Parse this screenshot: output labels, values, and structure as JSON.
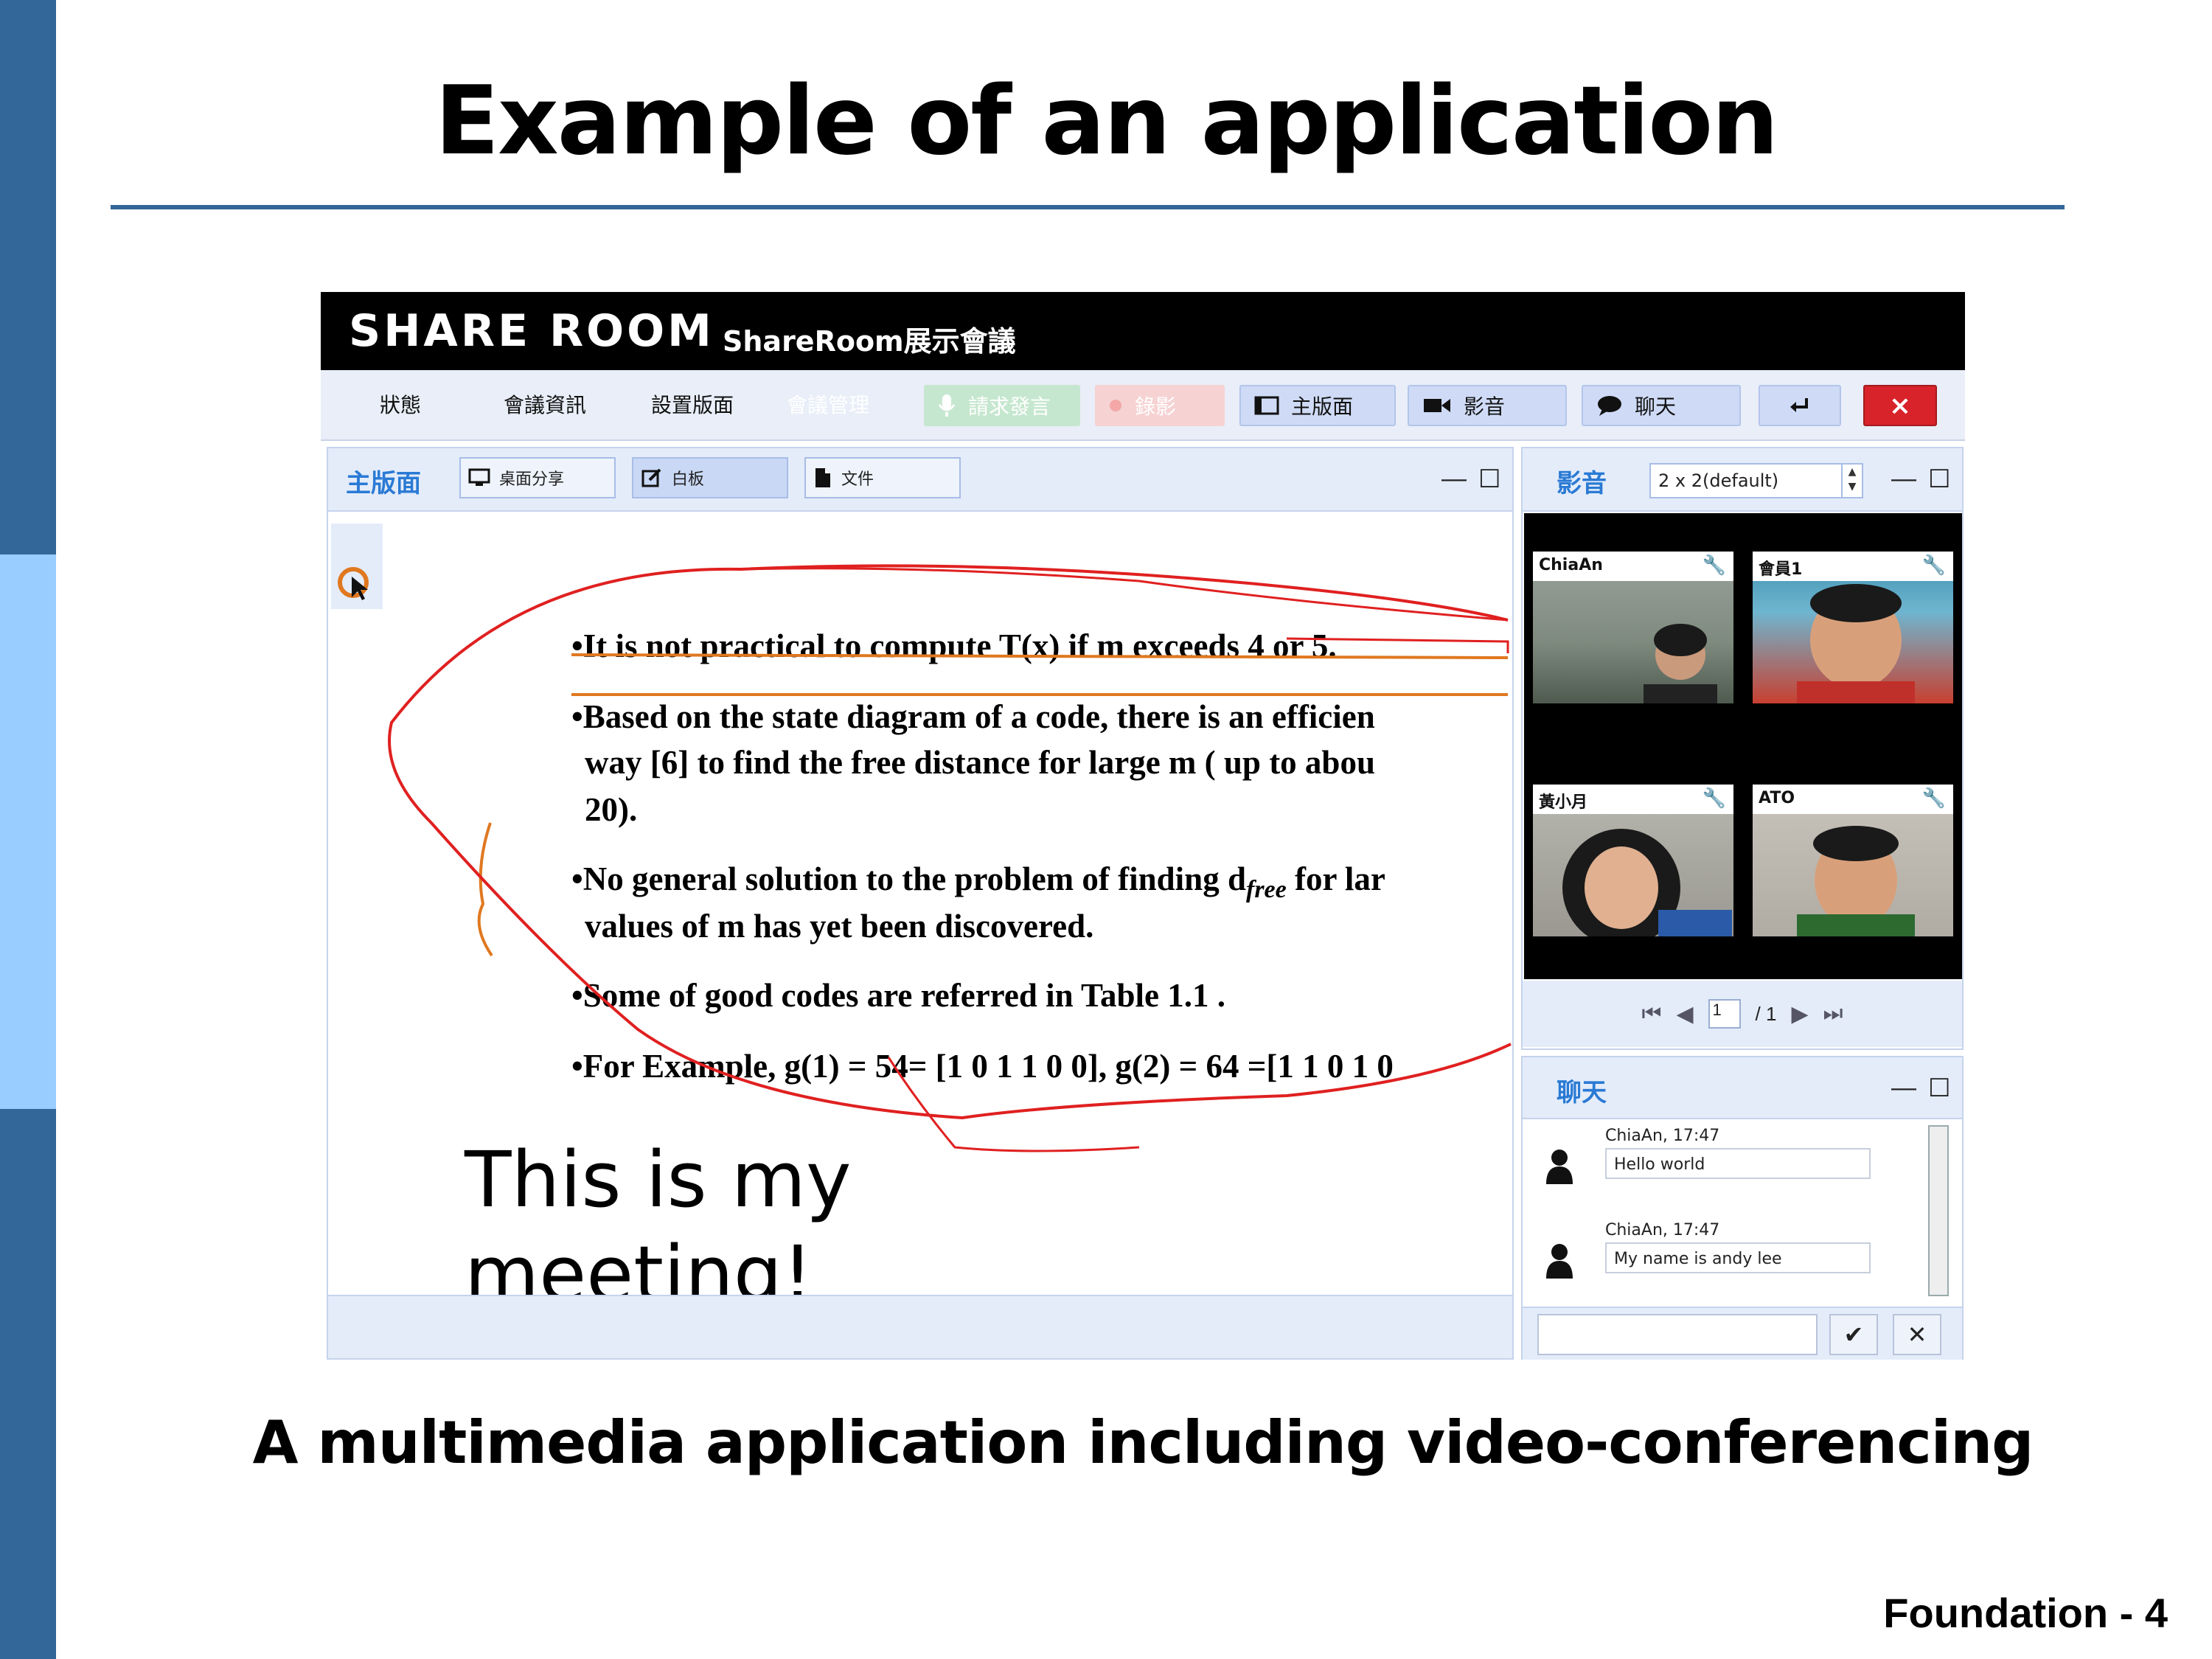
{
  "slide": {
    "title": "Example of an application",
    "caption": "A multimedia application including video-conferencing",
    "footer": "Foundation - 4"
  },
  "app": {
    "logo": "SHARE ROOM",
    "title": "ShareRoom展示會議",
    "menu": [
      "狀態",
      "會議資訊",
      "設置版面",
      "會議管理"
    ],
    "toolbar": {
      "request_speak": "請求發言",
      "record": "錄影",
      "main_view": "主版面",
      "video": "影音",
      "chat": "聊天",
      "close": "×"
    },
    "main_panel": {
      "label": "主版面",
      "tabs": [
        "桌面分享",
        "白板",
        "文件"
      ],
      "bullets": [
        "•It is not practical to compute T(x) if m exceeds 4 or 5.",
        "•Based on the state diagram of a code, there is an efficien",
        "way [6] to find the free distance for large m ( up to abou",
        "20).",
        "•No general solution to the problem of finding d",
        "values of m has yet been discovered.",
        "•Some of good codes are referred in Table 1.1 .",
        "•For Example, g(1) = 54= [1 0 1 1 0 0], g(2) = 64 =[1 1 0 1 0"
      ],
      "subscript": "free",
      "lar_suffix": " for lar",
      "note_line1": "This is my",
      "note_line2": "meeting!"
    },
    "video_panel": {
      "label": "影音",
      "layout": "2 x 2(default)",
      "participants": [
        "ChiaAn",
        "會員1",
        "黃小月",
        "ATO"
      ],
      "page_current": "1",
      "page_total": "/ 1"
    },
    "chat_panel": {
      "label": "聊天",
      "messages": [
        {
          "meta": "ChiaAn,  17:47",
          "text": "Hello world"
        },
        {
          "meta": "ChiaAn,  17:47",
          "text": "My name is andy lee"
        }
      ],
      "send": "✔",
      "cancel": "✕"
    }
  }
}
